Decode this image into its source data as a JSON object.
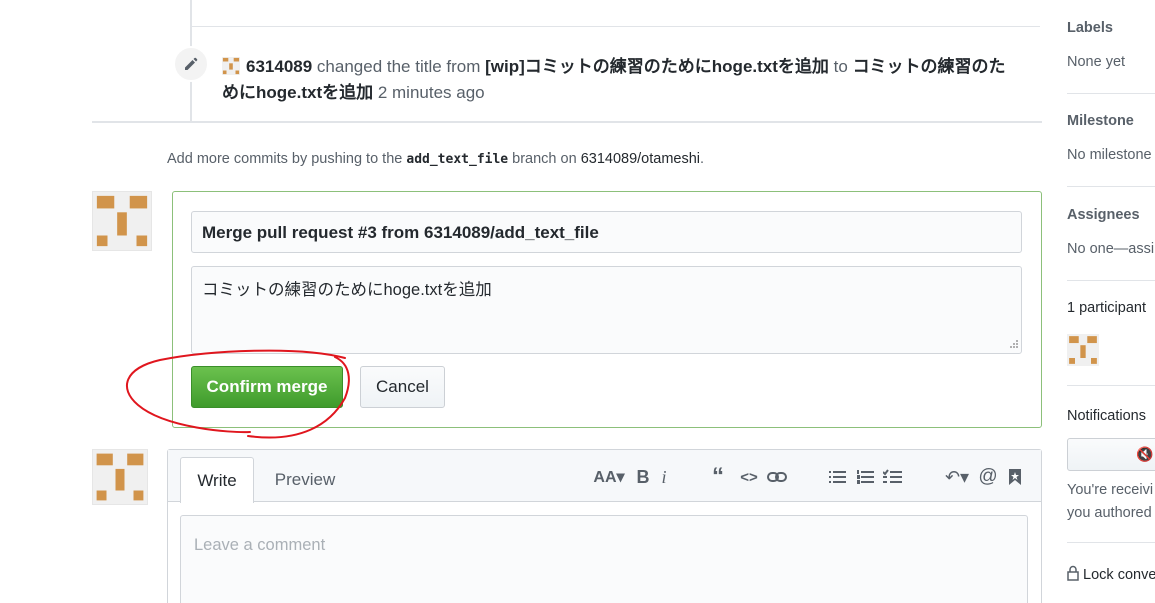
{
  "event": {
    "actor": "6314089",
    "verb": "changed the title from",
    "old_title": "[wip]コミットの練習のためにhoge.txtを追加",
    "connector": "to",
    "new_title_line1": "コミットの練習のた",
    "new_title_line2": "めにhoge.txtを追加",
    "time": "2 minutes ago"
  },
  "helper": {
    "prefix": "Add more commits by pushing to the",
    "branch": "add_text_file",
    "middle": "branch on",
    "repo": "6314089/otameshi",
    "suffix": "."
  },
  "merge": {
    "title_value": "Merge pull request #3 from 6314089/add_text_file",
    "message_value": "コミットの練習のためにhoge.txtを追加",
    "confirm_label": "Confirm merge",
    "cancel_label": "Cancel"
  },
  "comment": {
    "tabs": [
      "Write",
      "Preview"
    ],
    "placeholder": "Leave a comment",
    "toolbar": [
      "text-size-icon",
      "bold-icon",
      "italic-icon",
      "quote-icon",
      "code-icon",
      "link-icon",
      "unordered-list-icon",
      "ordered-list-icon",
      "task-list-icon",
      "reply-icon",
      "mention-icon",
      "bookmark-icon"
    ]
  },
  "sidebar": {
    "labels_title": "Labels",
    "labels_value": "None yet",
    "milestone_title": "Milestone",
    "milestone_value": "No milestone",
    "assignees_title": "Assignees",
    "assignees_value": "No one—assi",
    "participants_title": "1 participant",
    "notifications_title": "Notifications",
    "notifications_text_1": "You're receivi",
    "notifications_text_2": "you authored",
    "lock_label": "Lock conve"
  },
  "colors": {
    "accent_green": "#4cae37",
    "annotation_red": "#e0161e",
    "avatar_tile": "#d1944b"
  }
}
